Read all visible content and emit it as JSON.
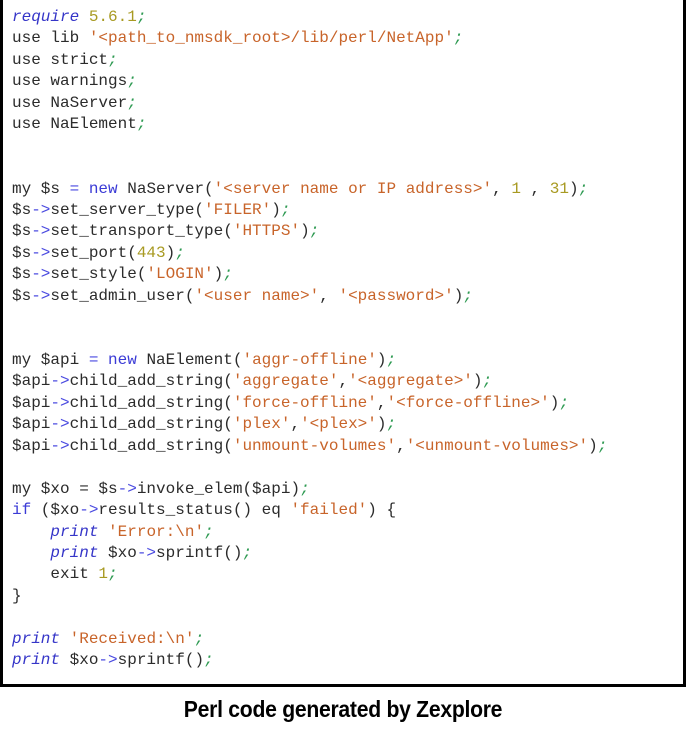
{
  "caption": "Perl code generated by Zexplore",
  "code": {
    "language": "Perl",
    "lines": [
      [
        {
          "t": "require",
          "c": "kw-i"
        },
        {
          "t": " "
        },
        {
          "t": "5.6.1",
          "c": "num"
        },
        {
          "t": ";",
          "c": "semi"
        }
      ],
      [
        {
          "t": "use lib "
        },
        {
          "t": "'<path_to_nmsdk_root>/lib/perl/NetApp'",
          "c": "str"
        },
        {
          "t": ";",
          "c": "semi"
        }
      ],
      [
        {
          "t": "use strict"
        },
        {
          "t": ";",
          "c": "semi"
        }
      ],
      [
        {
          "t": "use warnings"
        },
        {
          "t": ";",
          "c": "semi"
        }
      ],
      [
        {
          "t": "use NaServer"
        },
        {
          "t": ";",
          "c": "semi"
        }
      ],
      [
        {
          "t": "use NaElement"
        },
        {
          "t": ";",
          "c": "semi"
        }
      ],
      [],
      [],
      [
        {
          "t": "my $s "
        },
        {
          "t": "=",
          "c": "op"
        },
        {
          "t": " "
        },
        {
          "t": "new",
          "c": "kw"
        },
        {
          "t": " NaServer("
        },
        {
          "t": "'<server name or IP address>'",
          "c": "str"
        },
        {
          "t": ", "
        },
        {
          "t": "1",
          "c": "num"
        },
        {
          "t": " , "
        },
        {
          "t": "31",
          "c": "num"
        },
        {
          "t": ")"
        },
        {
          "t": ";",
          "c": "semi"
        }
      ],
      [
        {
          "t": "$s"
        },
        {
          "t": "->",
          "c": "op"
        },
        {
          "t": "set_server_type("
        },
        {
          "t": "'FILER'",
          "c": "str"
        },
        {
          "t": ")"
        },
        {
          "t": ";",
          "c": "semi"
        }
      ],
      [
        {
          "t": "$s"
        },
        {
          "t": "->",
          "c": "op"
        },
        {
          "t": "set_transport_type("
        },
        {
          "t": "'HTTPS'",
          "c": "str"
        },
        {
          "t": ")"
        },
        {
          "t": ";",
          "c": "semi"
        }
      ],
      [
        {
          "t": "$s"
        },
        {
          "t": "->",
          "c": "op"
        },
        {
          "t": "set_port("
        },
        {
          "t": "443",
          "c": "num"
        },
        {
          "t": ")"
        },
        {
          "t": ";",
          "c": "semi"
        }
      ],
      [
        {
          "t": "$s"
        },
        {
          "t": "->",
          "c": "op"
        },
        {
          "t": "set_style("
        },
        {
          "t": "'LOGIN'",
          "c": "str"
        },
        {
          "t": ")"
        },
        {
          "t": ";",
          "c": "semi"
        }
      ],
      [
        {
          "t": "$s"
        },
        {
          "t": "->",
          "c": "op"
        },
        {
          "t": "set_admin_user("
        },
        {
          "t": "'<user name>'",
          "c": "str"
        },
        {
          "t": ", "
        },
        {
          "t": "'<password>'",
          "c": "str"
        },
        {
          "t": ")"
        },
        {
          "t": ";",
          "c": "semi"
        }
      ],
      [],
      [],
      [
        {
          "t": "my $api "
        },
        {
          "t": "=",
          "c": "op"
        },
        {
          "t": " "
        },
        {
          "t": "new",
          "c": "kw"
        },
        {
          "t": " NaElement("
        },
        {
          "t": "'aggr-offline'",
          "c": "str"
        },
        {
          "t": ")"
        },
        {
          "t": ";",
          "c": "semi"
        }
      ],
      [
        {
          "t": "$api"
        },
        {
          "t": "->",
          "c": "op"
        },
        {
          "t": "child_add_string("
        },
        {
          "t": "'aggregate'",
          "c": "str"
        },
        {
          "t": ","
        },
        {
          "t": "'<aggregate>'",
          "c": "str"
        },
        {
          "t": ")"
        },
        {
          "t": ";",
          "c": "semi"
        }
      ],
      [
        {
          "t": "$api"
        },
        {
          "t": "->",
          "c": "op"
        },
        {
          "t": "child_add_string("
        },
        {
          "t": "'force-offline'",
          "c": "str"
        },
        {
          "t": ","
        },
        {
          "t": "'<force-offline>'",
          "c": "str"
        },
        {
          "t": ")"
        },
        {
          "t": ";",
          "c": "semi"
        }
      ],
      [
        {
          "t": "$api"
        },
        {
          "t": "->",
          "c": "op"
        },
        {
          "t": "child_add_string("
        },
        {
          "t": "'plex'",
          "c": "str"
        },
        {
          "t": ","
        },
        {
          "t": "'<plex>'",
          "c": "str"
        },
        {
          "t": ")"
        },
        {
          "t": ";",
          "c": "semi"
        }
      ],
      [
        {
          "t": "$api"
        },
        {
          "t": "->",
          "c": "op"
        },
        {
          "t": "child_add_string("
        },
        {
          "t": "'unmount-volumes'",
          "c": "str"
        },
        {
          "t": ","
        },
        {
          "t": "'<unmount-volumes>'",
          "c": "str"
        },
        {
          "t": ")"
        },
        {
          "t": ";",
          "c": "semi"
        }
      ],
      [],
      [
        {
          "t": "my $xo = $s"
        },
        {
          "t": "->",
          "c": "op"
        },
        {
          "t": "invoke_elem($api)"
        },
        {
          "t": ";",
          "c": "semi"
        }
      ],
      [
        {
          "t": "if",
          "c": "kw"
        },
        {
          "t": " ($xo"
        },
        {
          "t": "->",
          "c": "op"
        },
        {
          "t": "results_status() eq "
        },
        {
          "t": "'failed'",
          "c": "str"
        },
        {
          "t": ") {"
        }
      ],
      [
        {
          "t": "    "
        },
        {
          "t": "print",
          "c": "kw-i"
        },
        {
          "t": " "
        },
        {
          "t": "'Error:\\n'",
          "c": "str"
        },
        {
          "t": ";",
          "c": "semi"
        }
      ],
      [
        {
          "t": "    "
        },
        {
          "t": "print",
          "c": "kw-i"
        },
        {
          "t": " $xo"
        },
        {
          "t": "->",
          "c": "op"
        },
        {
          "t": "sprintf()"
        },
        {
          "t": ";",
          "c": "semi"
        }
      ],
      [
        {
          "t": "    exit "
        },
        {
          "t": "1",
          "c": "num"
        },
        {
          "t": ";",
          "c": "semi"
        }
      ],
      [
        {
          "t": "}"
        }
      ],
      [],
      [
        {
          "t": "print",
          "c": "kw-i"
        },
        {
          "t": " "
        },
        {
          "t": "'Received:\\n'",
          "c": "str"
        },
        {
          "t": ";",
          "c": "semi"
        }
      ],
      [
        {
          "t": "print",
          "c": "kw-i"
        },
        {
          "t": " $xo"
        },
        {
          "t": "->",
          "c": "op"
        },
        {
          "t": "sprintf()"
        },
        {
          "t": ";",
          "c": "semi"
        }
      ]
    ]
  }
}
